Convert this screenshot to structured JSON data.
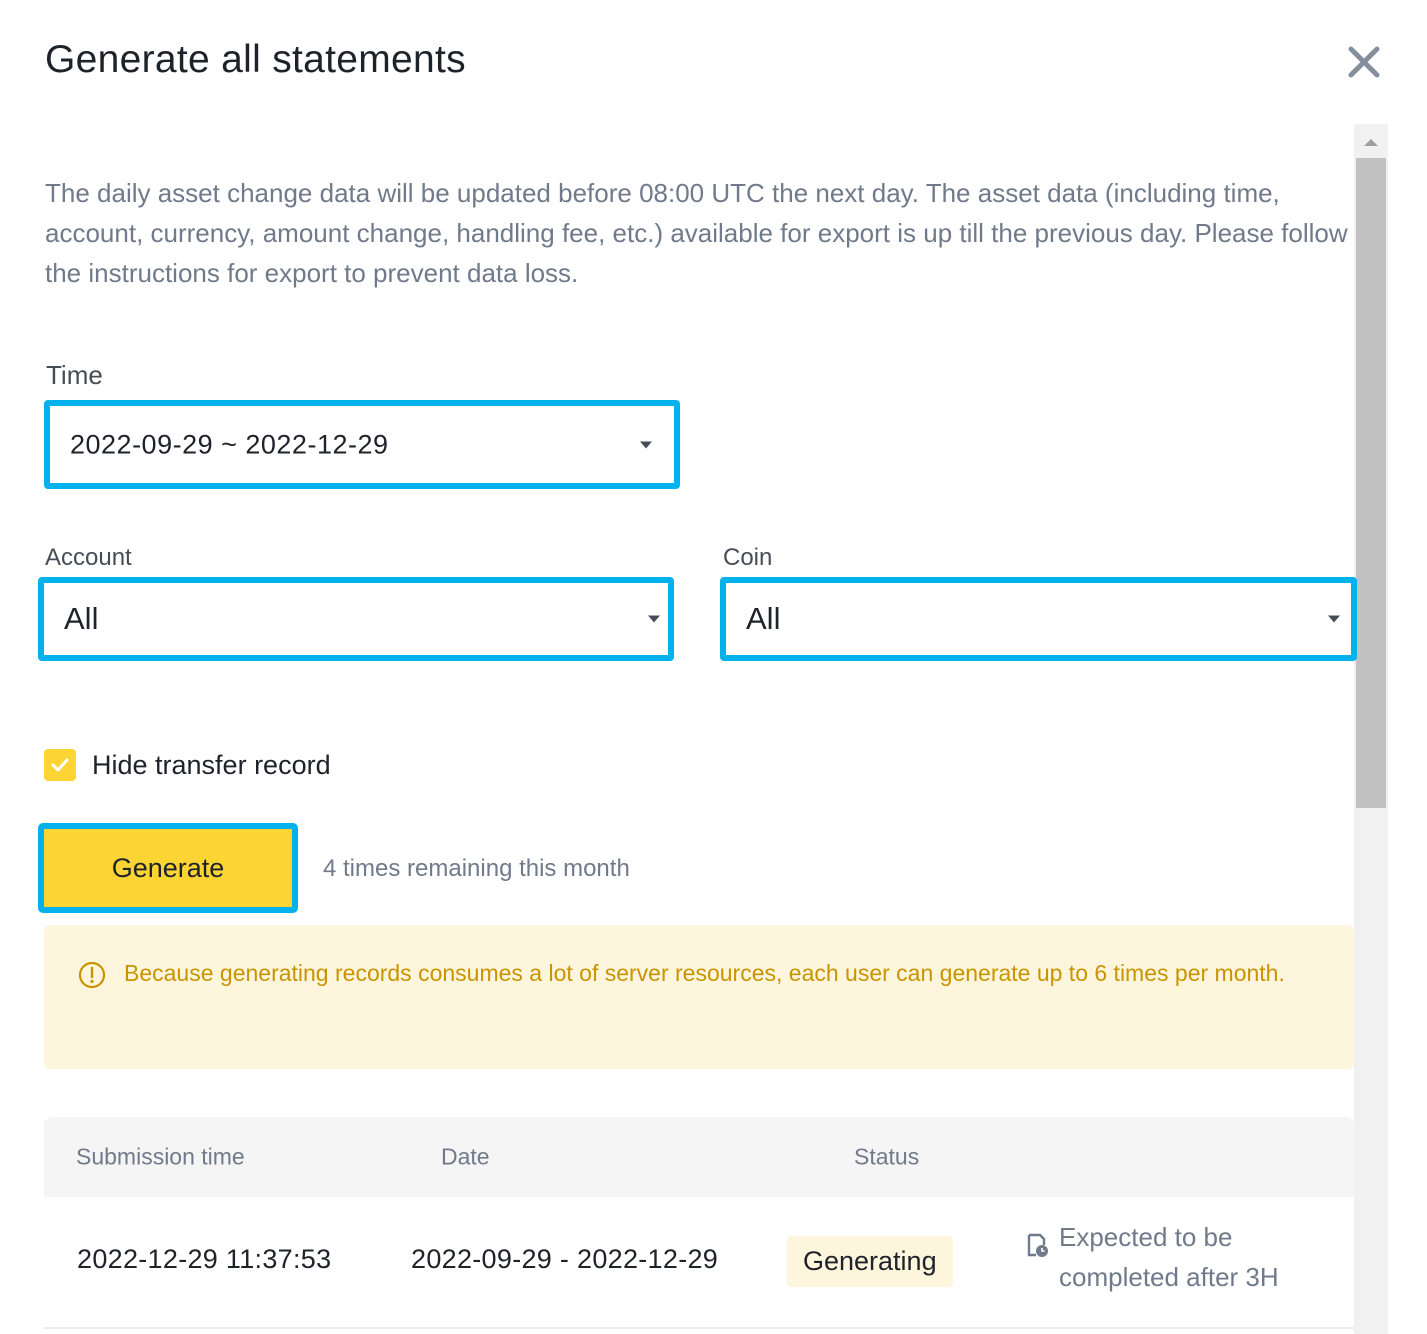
{
  "dialog": {
    "title": "Generate all statements",
    "description": "The daily asset change data will be updated before 08:00 UTC the next day. The asset data (including time, account, currency, amount change, handling fee, etc.) available for export is up till the previous day. Please follow the instructions for export to prevent data loss."
  },
  "form": {
    "time_label": "Time",
    "time_value": "2022-09-29 ~ 2022-12-29",
    "account_label": "Account",
    "account_value": "All",
    "coin_label": "Coin",
    "coin_value": "All",
    "hide_transfer_label": "Hide transfer record",
    "hide_transfer_checked": true,
    "generate_label": "Generate",
    "remaining_text": "4 times remaining this month"
  },
  "notice": {
    "text": "Because generating records consumes a lot of server resources, each user can generate up to 6 times per month."
  },
  "table": {
    "columns": [
      "Submission time",
      "Date",
      "Status"
    ],
    "rows": [
      {
        "submission_time": "2022-12-29 11:37:53",
        "date": "2022-09-29 - 2022-12-29",
        "status": "Generating",
        "expected": "Expected to be completed after 3H"
      }
    ]
  },
  "colors": {
    "accent": "#fcd535",
    "highlight_border": "#03b1ec",
    "notice_bg": "#fdf6dc",
    "notice_text": "#c99400"
  },
  "icons": {
    "close": "close-icon",
    "check": "checkmark-icon",
    "caret": "caret-down-icon",
    "info": "info-circle-icon",
    "clock_doc": "clock-document-icon"
  }
}
